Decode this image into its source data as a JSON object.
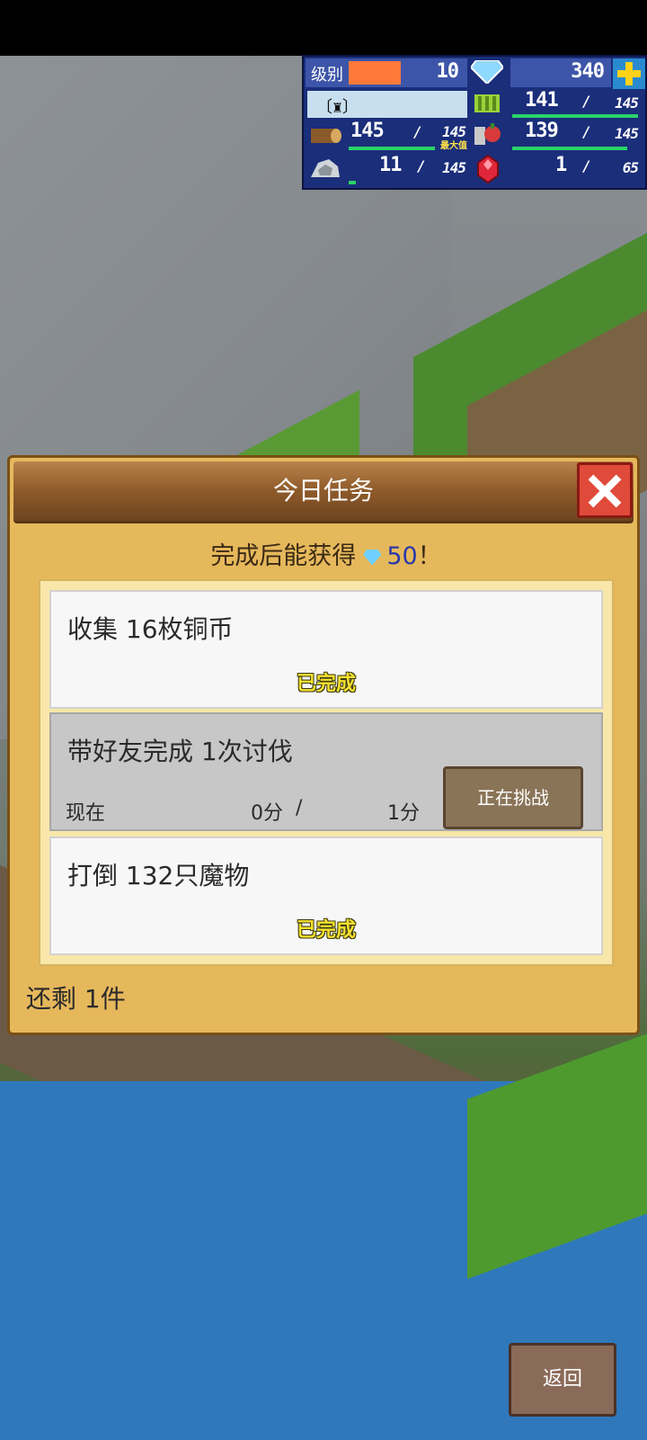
{
  "hud": {
    "level_label": "级别",
    "level_value": "10",
    "gems": "340",
    "rank_label": "〔♜〕",
    "wood_current": "145",
    "wood_max": "145",
    "wood_max_note": "最大值",
    "grass_current": "141",
    "grass_max": "145",
    "food_current": "139",
    "food_max": "145",
    "ore_current": "11",
    "ore_max": "145",
    "ruby_current": "1",
    "ruby_max": "65",
    "separator": "/"
  },
  "dialog": {
    "title": "今日任务",
    "reward_prefix": "完成后能获得",
    "reward_amount": "50",
    "reward_suffix": "！",
    "quests": [
      {
        "title": "收集 16枚铜币",
        "status": "已完成"
      },
      {
        "title": "带好友完成 1次讨伐",
        "now_label": "现在",
        "current": "0分",
        "sep": "/",
        "goal": "1分",
        "button": "正在挑战"
      },
      {
        "title": "打倒 132只魔物",
        "status": "已完成"
      }
    ],
    "remaining": "还剩 1件"
  },
  "back_button": "返回",
  "colors": {
    "accent_gold": "#e6b85c",
    "close_red": "#e04a3a",
    "done_yellow": "#f5e030",
    "hud_blue": "#1a2e7a"
  }
}
